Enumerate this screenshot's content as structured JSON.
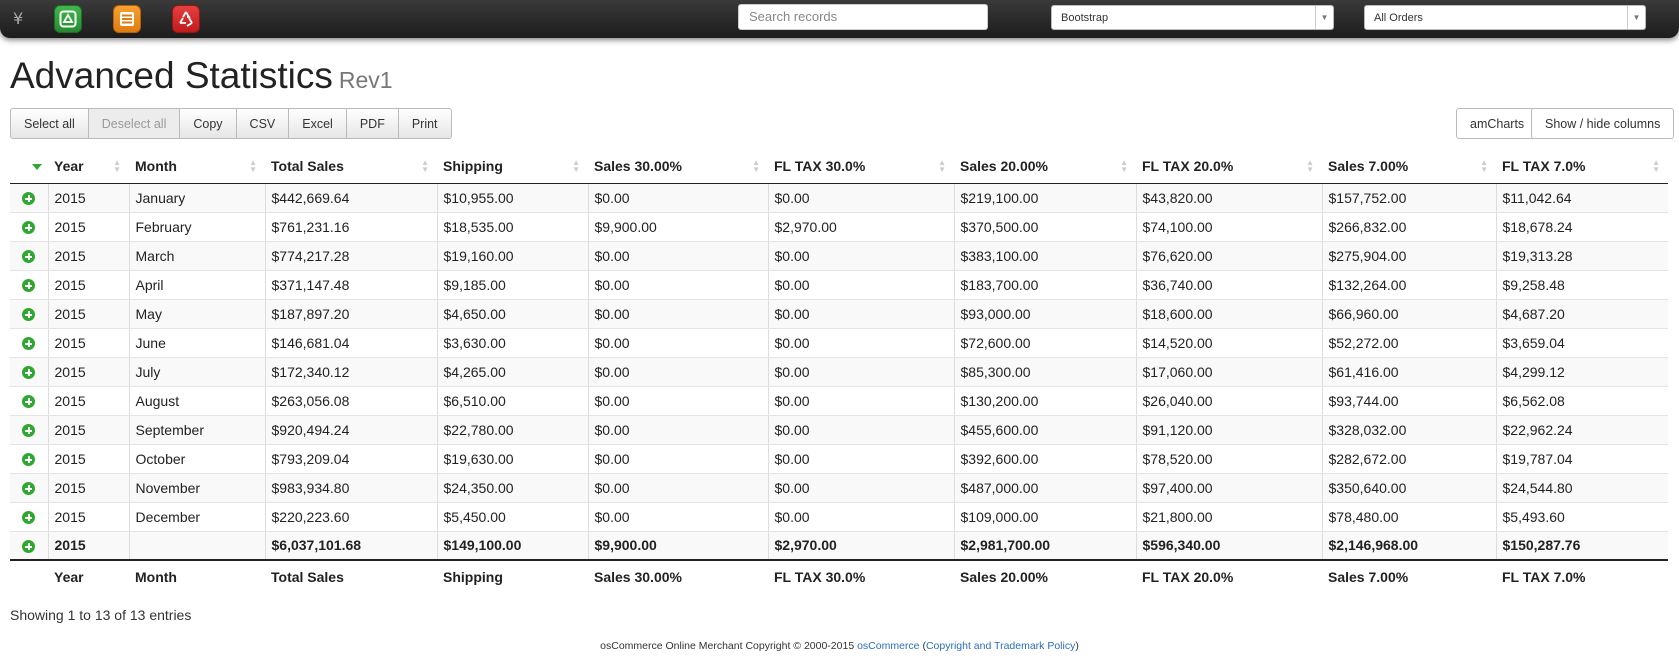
{
  "topbar": {
    "currency_symbol": "¥",
    "search_placeholder": "Search records",
    "template_select": "Bootstrap",
    "orders_select": "All Orders"
  },
  "page": {
    "title": "Advanced Statistics",
    "revision": "Rev1"
  },
  "toolbar": {
    "select_all": "Select all",
    "deselect_all": "Deselect all",
    "copy": "Copy",
    "csv": "CSV",
    "excel": "Excel",
    "pdf": "PDF",
    "print": "Print",
    "amcharts": "amCharts",
    "show_hide": "Show / hide columns"
  },
  "table": {
    "columns": [
      "Year",
      "Month",
      "Total Sales",
      "Shipping",
      "Sales 30.00%",
      "FL TAX 30.0%",
      "Sales 20.00%",
      "FL TAX 20.0%",
      "Sales 7.00%",
      "FL TAX 7.0%"
    ],
    "rows": [
      [
        "2015",
        "January",
        "$442,669.64",
        "$10,955.00",
        "$0.00",
        "$0.00",
        "$219,100.00",
        "$43,820.00",
        "$157,752.00",
        "$11,042.64"
      ],
      [
        "2015",
        "February",
        "$761,231.16",
        "$18,535.00",
        "$9,900.00",
        "$2,970.00",
        "$370,500.00",
        "$74,100.00",
        "$266,832.00",
        "$18,678.24"
      ],
      [
        "2015",
        "March",
        "$774,217.28",
        "$19,160.00",
        "$0.00",
        "$0.00",
        "$383,100.00",
        "$76,620.00",
        "$275,904.00",
        "$19,313.28"
      ],
      [
        "2015",
        "April",
        "$371,147.48",
        "$9,185.00",
        "$0.00",
        "$0.00",
        "$183,700.00",
        "$36,740.00",
        "$132,264.00",
        "$9,258.48"
      ],
      [
        "2015",
        "May",
        "$187,897.20",
        "$4,650.00",
        "$0.00",
        "$0.00",
        "$93,000.00",
        "$18,600.00",
        "$66,960.00",
        "$4,687.20"
      ],
      [
        "2015",
        "June",
        "$146,681.04",
        "$3,630.00",
        "$0.00",
        "$0.00",
        "$72,600.00",
        "$14,520.00",
        "$52,272.00",
        "$3,659.04"
      ],
      [
        "2015",
        "July",
        "$172,340.12",
        "$4,265.00",
        "$0.00",
        "$0.00",
        "$85,300.00",
        "$17,060.00",
        "$61,416.00",
        "$4,299.12"
      ],
      [
        "2015",
        "August",
        "$263,056.08",
        "$6,510.00",
        "$0.00",
        "$0.00",
        "$130,200.00",
        "$26,040.00",
        "$93,744.00",
        "$6,562.08"
      ],
      [
        "2015",
        "September",
        "$920,494.24",
        "$22,780.00",
        "$0.00",
        "$0.00",
        "$455,600.00",
        "$91,120.00",
        "$328,032.00",
        "$22,962.24"
      ],
      [
        "2015",
        "October",
        "$793,209.04",
        "$19,630.00",
        "$0.00",
        "$0.00",
        "$392,600.00",
        "$78,520.00",
        "$282,672.00",
        "$19,787.04"
      ],
      [
        "2015",
        "November",
        "$983,934.80",
        "$24,350.00",
        "$0.00",
        "$0.00",
        "$487,000.00",
        "$97,400.00",
        "$350,640.00",
        "$24,544.80"
      ],
      [
        "2015",
        "December",
        "$220,223.60",
        "$5,450.00",
        "$0.00",
        "$0.00",
        "$109,000.00",
        "$21,800.00",
        "$78,480.00",
        "$5,493.60"
      ]
    ],
    "total": [
      "2015",
      "",
      "$6,037,101.68",
      "$149,100.00",
      "$9,900.00",
      "$2,970.00",
      "$2,981,700.00",
      "$596,340.00",
      "$2,146,968.00",
      "$150,287.76"
    ]
  },
  "info": "Showing 1 to 13 of 13 entries",
  "footer": {
    "copyright": "osCommerce Online Merchant Copyright © 2000-2015 ",
    "link1": "osCommerce",
    "paren_open": " (",
    "link2": "Copyright and Trademark Policy",
    "paren_close": ")"
  },
  "colors": {
    "accent_green": "#2ea82e",
    "link_blue": "#2a6fb8"
  }
}
